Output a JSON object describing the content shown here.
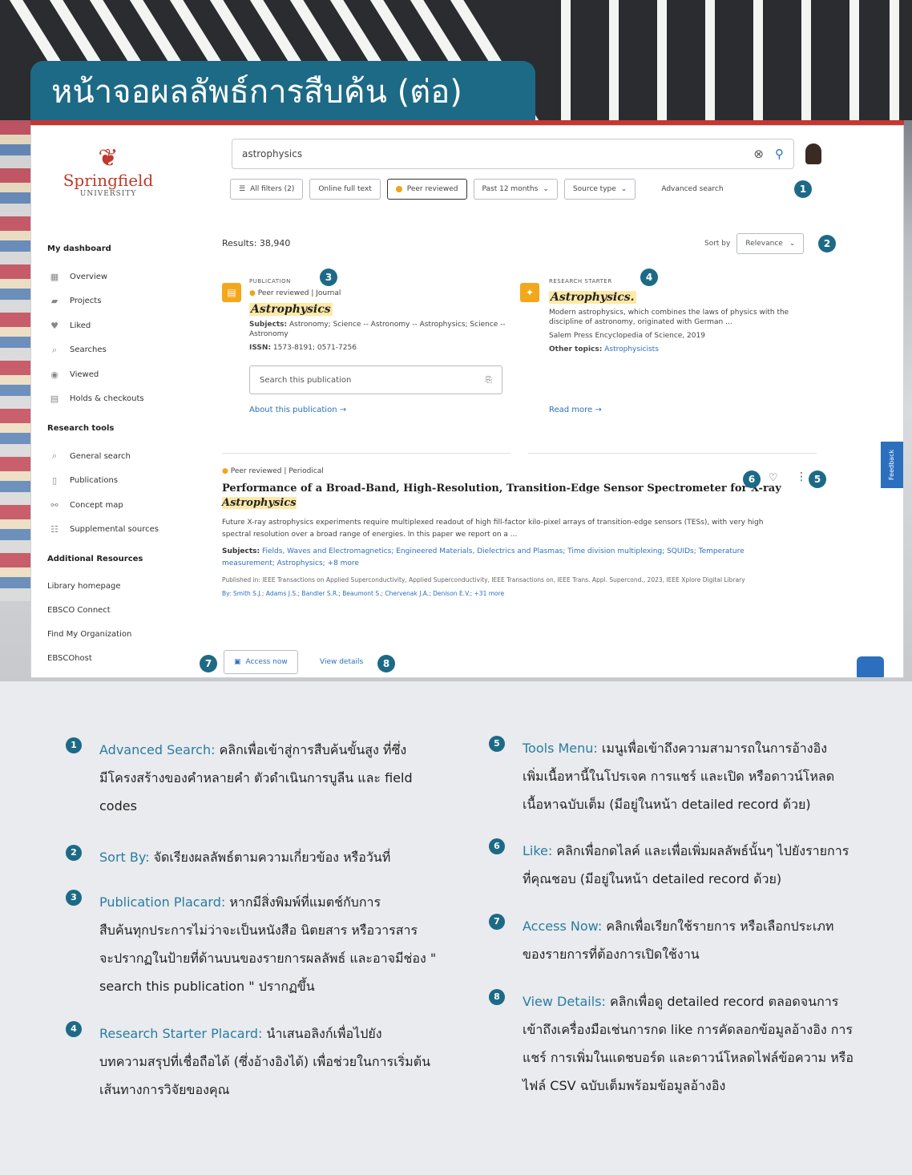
{
  "page_title": "หน้าจอผลลัพธ์การสืบค้น (ต่อ)",
  "logo": {
    "name": "Springfield",
    "sub": "UNIVERSITY"
  },
  "search": {
    "query": "astrophysics"
  },
  "filters": {
    "all_filters": "All filters (2)",
    "online_full_text": "Online full text",
    "peer_reviewed": "Peer reviewed",
    "date": "Past 12 months",
    "source_type": "Source type",
    "advanced": "Advanced search"
  },
  "sidebar": {
    "dashboard_head": "My dashboard",
    "dashboard_items": [
      {
        "label": "Overview",
        "icon": "grid-icon"
      },
      {
        "label": "Projects",
        "icon": "folder-icon"
      },
      {
        "label": "Liked",
        "icon": "heart-icon"
      },
      {
        "label": "Searches",
        "icon": "search-icon"
      },
      {
        "label": "Viewed",
        "icon": "eye-icon"
      },
      {
        "label": "Holds & checkouts",
        "icon": "book-icon"
      }
    ],
    "tools_head": "Research tools",
    "tools_items": [
      {
        "label": "General search",
        "icon": "search-icon"
      },
      {
        "label": "Publications",
        "icon": "document-icon"
      },
      {
        "label": "Concept map",
        "icon": "network-icon"
      },
      {
        "label": "Supplemental sources",
        "icon": "list-icon"
      }
    ],
    "resources_head": "Additional Resources",
    "resources_items": [
      "Library homepage",
      "EBSCO Connect",
      "Find My Organization",
      "EBSCOhost"
    ]
  },
  "results": {
    "count": "Results: 38,940",
    "sort_label": "Sort by",
    "sort_value": "Relevance"
  },
  "publication": {
    "type": "PUBLICATION",
    "peer": "Peer reviewed",
    "kind": "Journal",
    "title": "Astrophysics",
    "subjects_label": "Subjects:",
    "subjects": "Astronomy; Science -- Astronomy -- Astrophysics; Science -- Astronomy",
    "issn_label": "ISSN:",
    "issn": "1573-8191; 0571-7256",
    "search_placeholder": "Search this publication",
    "about": "About this publication →"
  },
  "research_starter": {
    "type": "RESEARCH STARTER",
    "title": "Astrophysics.",
    "desc": "Modern astrophysics, which combines the laws of physics with the discipline of astronomy, originated with German ...",
    "source": "Salem Press Encyclopedia of Science, 2019",
    "other_label": "Other topics:",
    "other": "Astrophysicists",
    "read_more": "Read more →"
  },
  "article": {
    "peer": "Peer reviewed",
    "kind": "Periodical",
    "title_plain": "Performance of a Broad-Band, High-Resolution, Transition-Edge Sensor Spectrometer for X-ray ",
    "title_hl": "Astrophysics",
    "abstract": "Future X-ray astrophysics experiments require multiplexed readout of high fill-factor kilo-pixel arrays of transition-edge sensors (TESs), with very high spectral resolution over a broad range of energies. In this paper we report on a ...",
    "subjects_label": "Subjects:",
    "subjects": "Fields, Waves and Electromagnetics; Engineered Materials, Dielectrics and Plasmas; Time division multiplexing; SQUIDs; Temperature measurement; Astrophysics; +8 more",
    "published": "Published in: IEEE Transactions on Applied Superconductivity, Applied Superconductivity, IEEE Transactions on, IEEE Trans. Appl. Supercond., 2023, IEEE Xplore Digital Library",
    "by": "By: Smith S.J.; Adams J.S.; Bandler S.R.; Beaumont S.; Chervenak J.A.; Denison E.V.; +31 more",
    "access": "Access now",
    "view": "View details"
  },
  "feedback": "Feedback",
  "legend": [
    {
      "num": "1",
      "term": "Advanced Search:",
      "lines": [
        "คลิกเพื่อเข้าสู่การสืบค้นขั้นสูง ที่ซึ่ง",
        "มีโครงสร้างของคำหลายคำ ตัวดำเนินการบูลีน และ field",
        "codes"
      ]
    },
    {
      "num": "2",
      "term": "Sort By:",
      "lines": [
        "จัดเรียงผลลัพธ์ตามความเกี่ยวข้อง หรือวันที่"
      ]
    },
    {
      "num": "3",
      "term": "Publication Placard:",
      "lines": [
        "หากมีสิ่งพิมพ์ที่แมตช์กับการ",
        "สืบค้นทุกประการไม่ว่าจะเป็นหนังสือ นิตยสาร หรือวารสาร",
        "จะปรากฏในป้ายที่ด้านบนของรายการผลลัพธ์ และอาจมีช่อง \"",
        "search this publication \" ปรากฏขึ้น"
      ]
    },
    {
      "num": "4",
      "term": "Research Starter Placard:",
      "lines": [
        "นำเสนอลิงก์เพื่อไปยัง",
        "บทความสรุปที่เชื่อถือได้ (ซึ่งอ้างอิงได้) เพื่อช่วยในการเริ่มต้น",
        "เส้นทางการวิจัยของคุณ"
      ]
    },
    {
      "num": "5",
      "term": "Tools Menu:",
      "lines": [
        "เมนูเพื่อเข้าถึงความสามารถในการอ้างอิง",
        "เพิ่มเนื้อหานี้ในโปรเจค การแชร์ และเปิด หรือดาวน์โหลด",
        "เนื้อหาฉบับเต็ม (มีอยู่ในหน้า detailed record ด้วย)"
      ]
    },
    {
      "num": "6",
      "term": "Like:",
      "lines": [
        "คลิกเพื่อกดไลค์ และเพื่อเพิ่มผลลัพธ์นั้นๆ ไปยังรายการ",
        "ที่คุณชอบ (มีอยู่ในหน้า detailed record ด้วย)"
      ]
    },
    {
      "num": "7",
      "term": "Access Now:",
      "lines": [
        "คลิกเพื่อเรียกใช้รายการ หรือเลือกประเภท",
        "ของรายการที่ต้องการเปิดใช้งาน"
      ]
    },
    {
      "num": "8",
      "term": "View Details:",
      "lines": [
        "คลิกเพื่อดู detailed record ตลอดจนการ",
        "เข้าถึงเครื่องมือเช่นการกด like การคัดลอกข้อมูลอ้างอิง การ",
        "แชร์ การเพิ่มในแดชบอร์ด และดาวน์โหลดไฟล์ข้อความ หรือ",
        "ไฟล์ CSV ฉบับเต็มพร้อมข้อมูลอ้างอิง"
      ]
    }
  ]
}
